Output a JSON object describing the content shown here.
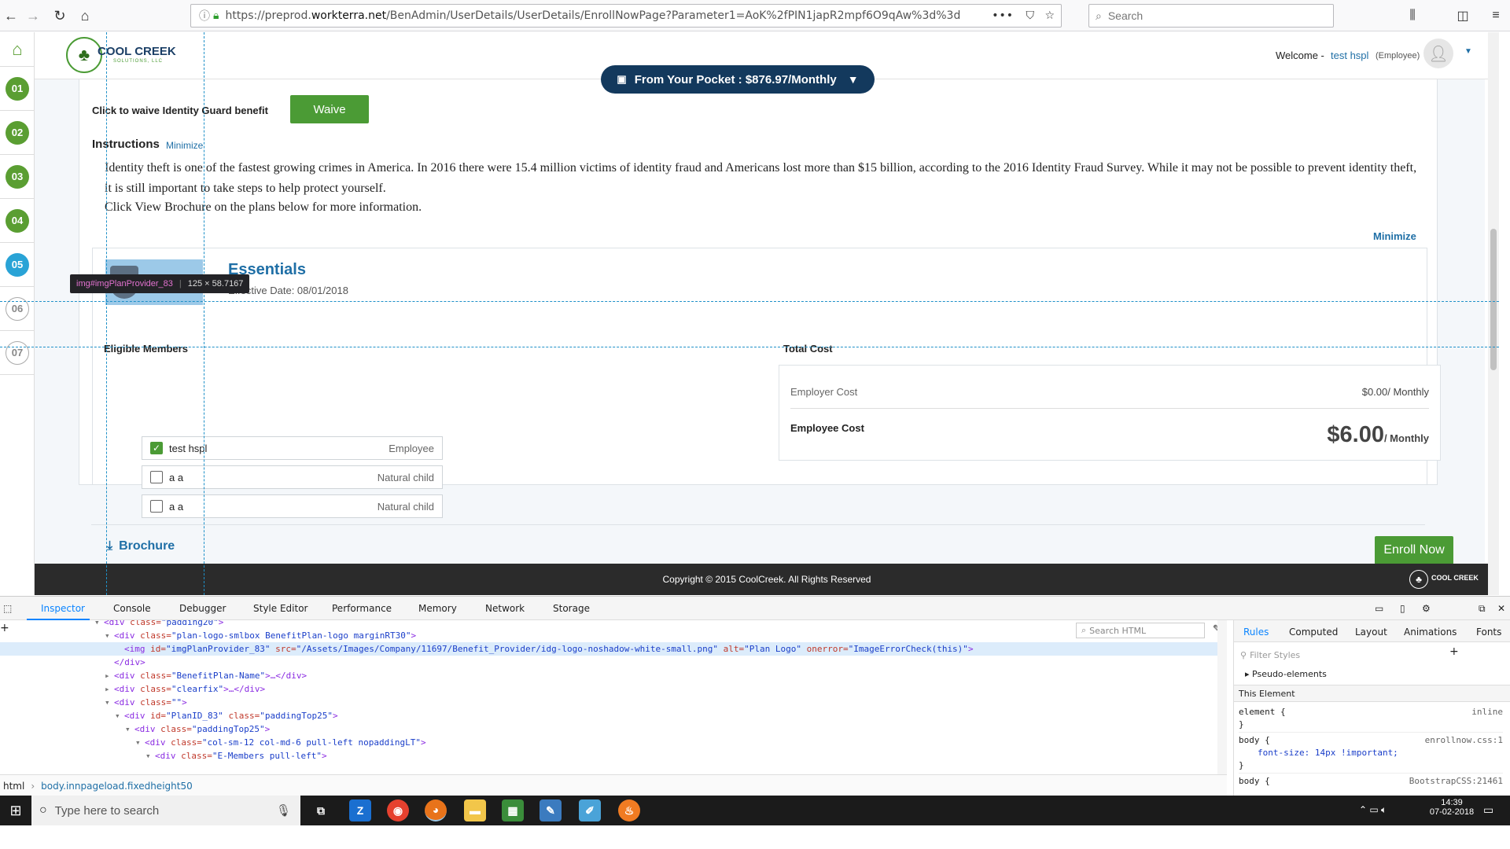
{
  "browser": {
    "url_prefix": "https://preprod.",
    "url_domain": "workterra.net",
    "url_rest": "/BenAdmin/UserDetails/UserDetails/EnrollNowPage?Parameter1=AoK%2fPIN1japR2mpf6O9qAw%3d%3d",
    "search_placeholder": "Search"
  },
  "header": {
    "logo_text": "COOL CREEK",
    "logo_sub": "SOLUTIONS, LLC",
    "welcome_label": "Welcome -",
    "user_name": "test hspl",
    "user_role": "(Employee)"
  },
  "pocket": {
    "label": "From Your Pocket : $876.97/Monthly"
  },
  "steps": [
    "01",
    "02",
    "03",
    "04",
    "05",
    "06",
    "07"
  ],
  "waive": {
    "text": "Click to waive Identity Guard benefit",
    "button": "Waive"
  },
  "instructions": {
    "title": "Instructions",
    "minimize": "Minimize",
    "para1": "Identity theft is one of the fastest growing crimes in America. In 2016 there were 15.4 million victims of identity fraud and Americans lost more than $15 billion, according to the 2016 Identity Fraud Survey. While it may not be possible to prevent identity theft, it is still important to take steps to help protect yourself.",
    "para2": "Click View Brochure on the plans below for more information.",
    "minimize_right": "Minimize"
  },
  "tooltip": {
    "selector": "img#imgPlanProvider_83",
    "size": "125 × 58.7167"
  },
  "plan": {
    "name": "Essentials",
    "effective": "Effective Date: 08/01/2018",
    "eligible_title": "Eligible Members",
    "members": [
      {
        "name": "test hspl",
        "relation": "Employee",
        "checked": true
      },
      {
        "name": "a a",
        "relation": "Natural child",
        "checked": false
      },
      {
        "name": "a a",
        "relation": "Natural child",
        "checked": false
      }
    ],
    "total_title": "Total Cost",
    "employer_label": "Employer Cost",
    "employer_value": "$0.00/ Monthly",
    "employee_label": "Employee Cost",
    "employee_value": "$6.00",
    "employee_unit": "/ Monthly",
    "brochure": "Brochure",
    "enroll": "Enroll Now"
  },
  "footer": {
    "copyright": "Copyright © 2015 CoolCreek. All Rights Reserved",
    "logo_text": "COOL CREEK"
  },
  "devtools": {
    "tabs": [
      "Inspector",
      "Console",
      "Debugger",
      "Style Editor",
      "Performance",
      "Memory",
      "Network",
      "Storage"
    ],
    "search_html": "Search HTML",
    "markup": [
      {
        "indent": 0,
        "tw": "▾",
        "html": [
          [
            "t",
            "<div "
          ],
          [
            "a",
            "class="
          ],
          [
            "v",
            "\"padding20\""
          ],
          [
            "t",
            ">"
          ]
        ]
      },
      {
        "indent": 1,
        "tw": "▾",
        "html": [
          [
            "t",
            "<div "
          ],
          [
            "a",
            "class="
          ],
          [
            "v",
            "\"plan-logo-smlbox BenefitPlan-logo marginRT30\""
          ],
          [
            "t",
            ">"
          ]
        ]
      },
      {
        "indent": 2,
        "tw": "",
        "html": [
          [
            "t",
            "<img "
          ],
          [
            "a",
            "id="
          ],
          [
            "v",
            "\"imgPlanProvider_83\" "
          ],
          [
            "a",
            "src="
          ],
          [
            "v",
            "\"/Assets/Images/Company/11697/Benefit_Provider/idg-logo-noshadow-white-small.png\" "
          ],
          [
            "a",
            "alt="
          ],
          [
            "v",
            "\"Plan Logo\" "
          ],
          [
            "a",
            "onerror="
          ],
          [
            "v",
            "\"ImageErrorCheck(this)\""
          ],
          [
            "t",
            ">"
          ]
        ],
        "selected": true
      },
      {
        "indent": 1,
        "tw": "",
        "html": [
          [
            "t",
            "</div>"
          ]
        ]
      },
      {
        "indent": 1,
        "tw": "▸",
        "html": [
          [
            "t",
            "<div "
          ],
          [
            "a",
            "class="
          ],
          [
            "v",
            "\"BenefitPlan-Name\""
          ],
          [
            "t",
            ">…</div>"
          ]
        ]
      },
      {
        "indent": 1,
        "tw": "▸",
        "html": [
          [
            "t",
            "<div "
          ],
          [
            "a",
            "class="
          ],
          [
            "v",
            "\"clearfix\""
          ],
          [
            "t",
            ">…</div>"
          ]
        ]
      },
      {
        "indent": 1,
        "tw": "▾",
        "html": [
          [
            "t",
            "<div "
          ],
          [
            "a",
            "class="
          ],
          [
            "v",
            "\"\""
          ],
          [
            "t",
            ">"
          ]
        ]
      },
      {
        "indent": 2,
        "tw": "▾",
        "html": [
          [
            "t",
            "<div "
          ],
          [
            "a",
            "id="
          ],
          [
            "v",
            "\"PlanID_83\" "
          ],
          [
            "a",
            "class="
          ],
          [
            "v",
            "\"paddingTop25\""
          ],
          [
            "t",
            ">"
          ]
        ]
      },
      {
        "indent": 3,
        "tw": "▾",
        "html": [
          [
            "t",
            "<div "
          ],
          [
            "a",
            "class="
          ],
          [
            "v",
            "\"paddingTop25\""
          ],
          [
            "t",
            ">"
          ]
        ]
      },
      {
        "indent": 4,
        "tw": "▾",
        "html": [
          [
            "t",
            "<div "
          ],
          [
            "a",
            "class="
          ],
          [
            "v",
            "\"col-sm-12 col-md-6 pull-left nopaddingLT\""
          ],
          [
            "t",
            ">"
          ]
        ]
      },
      {
        "indent": 5,
        "tw": "▾",
        "html": [
          [
            "t",
            "<div "
          ],
          [
            "a",
            "class="
          ],
          [
            "v",
            "\"E-Members pull-left\""
          ],
          [
            "t",
            ">"
          ]
        ]
      }
    ],
    "breadcrumb": [
      "html",
      "body.innpageload.fixedheight50"
    ],
    "rules_tabs": [
      "Rules",
      "Computed",
      "Layout",
      "Animations",
      "Fonts"
    ],
    "filter_placeholder": "Filter Styles",
    "pseudo": "Pseudo-elements",
    "this_element": "This Element",
    "rule1_sel": "element",
    "rule1_src": "inline",
    "rule2_sel": "body",
    "rule2_src": "enrollnow.css:1",
    "rule2_decl": "font-size: 14px !important;",
    "rule3_sel": "body",
    "rule3_src": "BootstrapCSS:21461",
    "brace_open": "{",
    "brace_close": "}"
  },
  "taskbar": {
    "search_placeholder": "Type here to search",
    "time": "14:39",
    "date": "07-02-2018"
  },
  "colors": {
    "brand_navy": "#13395d",
    "green": "#4b9b35",
    "link_blue": "#1f6fa6",
    "step_current": "#29a3d6"
  }
}
